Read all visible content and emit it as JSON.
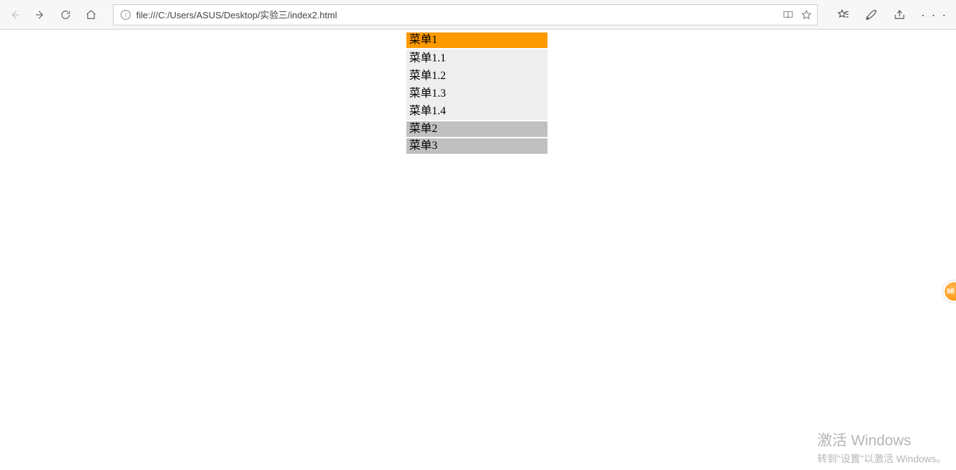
{
  "browser": {
    "url": "file:///C:/Users/ASUS/Desktop/实验三/index2.html",
    "info_glyph": "i"
  },
  "menu": {
    "items": [
      {
        "label": "菜单1",
        "active": true,
        "children": [
          {
            "label": "菜单1.1"
          },
          {
            "label": "菜单1.2"
          },
          {
            "label": "菜单1.3"
          },
          {
            "label": "菜单1.4"
          }
        ]
      },
      {
        "label": "菜单2",
        "active": false,
        "children": []
      },
      {
        "label": "菜单3",
        "active": false,
        "children": []
      }
    ]
  },
  "watermark": {
    "line1": "激活 Windows",
    "line2": "转到\"设置\"以激活 Windows。"
  },
  "float_badge": {
    "text": "98"
  },
  "colors": {
    "menu_active_bg": "#ff9900",
    "menu_head_bg": "#c0c0c0",
    "submenu_bg": "#eeeeee"
  }
}
